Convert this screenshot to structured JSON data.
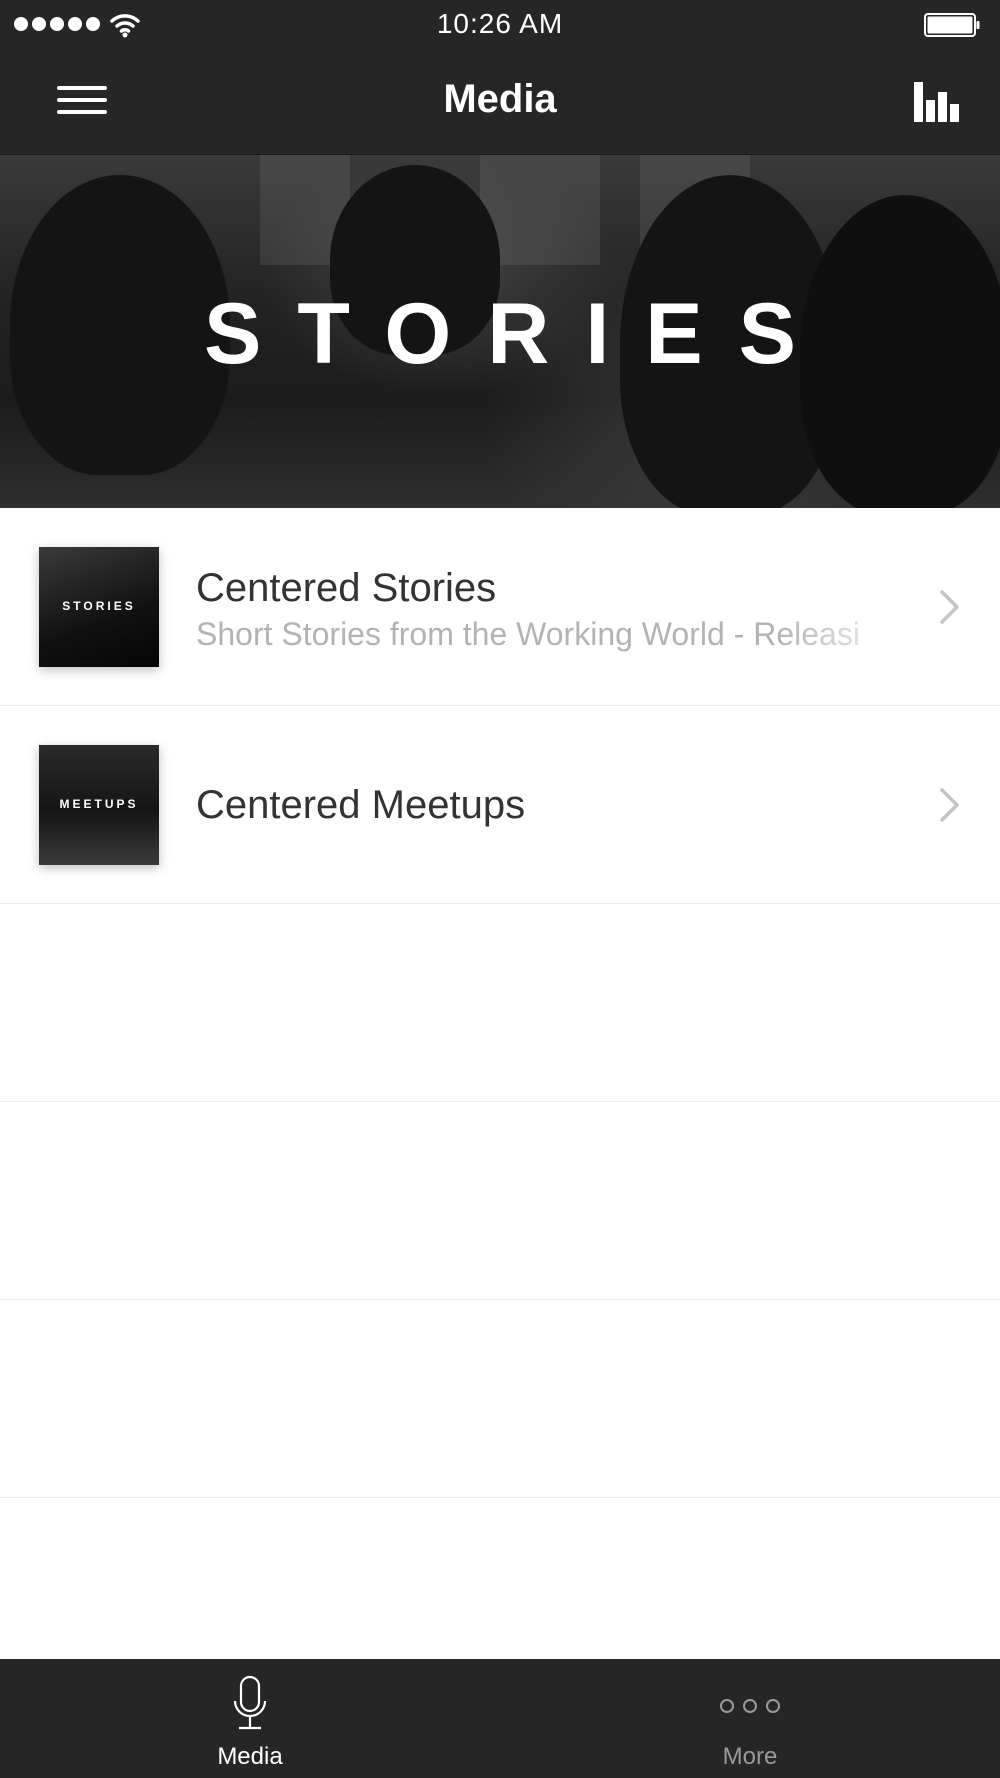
{
  "status_bar": {
    "time": "10:26 AM"
  },
  "nav": {
    "title": "Media",
    "left_icon": "hamburger-menu-icon",
    "right_icon": "bar-chart-icon"
  },
  "hero": {
    "title": "STORIES"
  },
  "channels": [
    {
      "title": "Centered Stories",
      "subtitle": "Short Stories from the Working World - Releasi",
      "thumb_label": "STORIES"
    },
    {
      "title": "Centered Meetups",
      "subtitle": "",
      "thumb_label": "MEETUPS"
    }
  ],
  "tabbar": {
    "tabs": [
      {
        "label": "Media",
        "icon": "microphone-icon",
        "active": true
      },
      {
        "label": "More",
        "icon": "more-dots-icon",
        "active": false
      }
    ]
  },
  "colors": {
    "bar_background": "#262626",
    "active_tab": "#ffffff",
    "inactive_tab": "#9a9a9a"
  }
}
